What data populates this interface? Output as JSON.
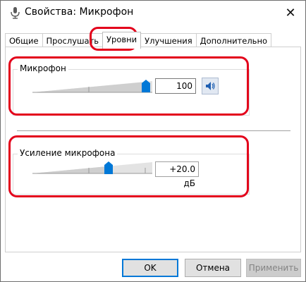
{
  "window": {
    "title": "Свойства: Микрофон",
    "close_symbol": "✕"
  },
  "tabs": [
    {
      "label": "Общие",
      "active": false
    },
    {
      "label": "Прослушать",
      "active": false
    },
    {
      "label": "Уровни",
      "active": true
    },
    {
      "label": "Улучшения",
      "active": false
    },
    {
      "label": "Дополнительно",
      "active": false
    }
  ],
  "microphone": {
    "label": "Микрофон",
    "value": "100",
    "level_percent": 100,
    "mute_icon": "speaker-icon"
  },
  "boost": {
    "label": "Усиление микрофона",
    "value": "+20.0 дБ",
    "level_fraction": 0.67
  },
  "buttons": {
    "ok": "OK",
    "cancel": "Отмена",
    "apply": "Применить"
  },
  "colors": {
    "accent": "#0078d7",
    "annotation": "#e3001b"
  }
}
